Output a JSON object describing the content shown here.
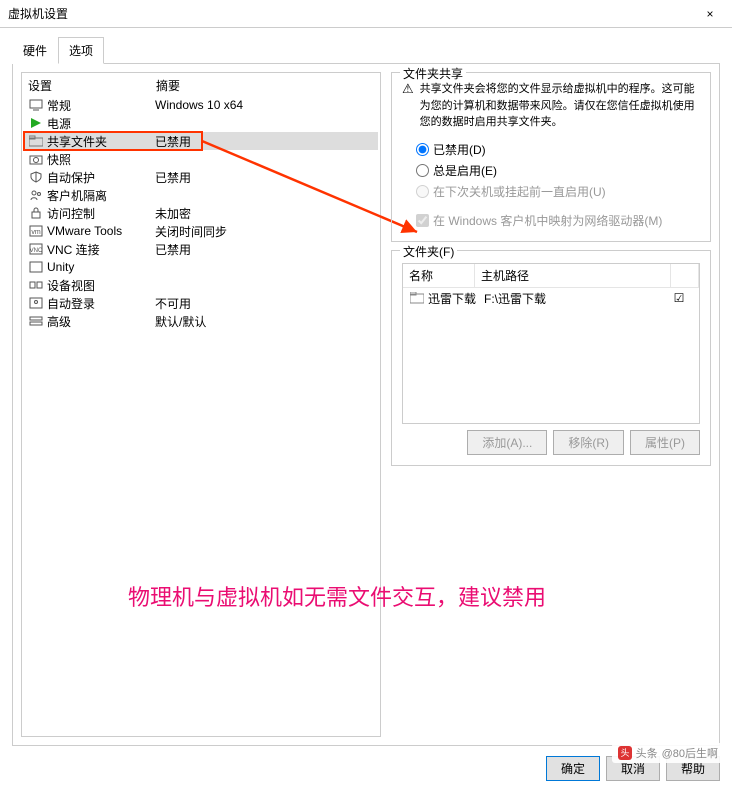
{
  "window": {
    "title": "虚拟机设置",
    "close_icon": "×"
  },
  "tabs": {
    "hardware": "硬件",
    "options": "选项"
  },
  "list": {
    "header": {
      "setting": "设置",
      "summary": "摘要"
    },
    "rows": [
      {
        "icon": "monitor",
        "label": "常规",
        "summary": "Windows 10 x64"
      },
      {
        "icon": "power",
        "label": "电源",
        "summary": ""
      },
      {
        "icon": "folder",
        "label": "共享文件夹",
        "summary": "已禁用",
        "selected": true
      },
      {
        "icon": "camera",
        "label": "快照",
        "summary": ""
      },
      {
        "icon": "shield",
        "label": "自动保护",
        "summary": "已禁用"
      },
      {
        "icon": "people",
        "label": "客户机隔离",
        "summary": ""
      },
      {
        "icon": "lock",
        "label": "访问控制",
        "summary": "未加密"
      },
      {
        "icon": "vm",
        "label": "VMware Tools",
        "summary": "关闭时间同步"
      },
      {
        "icon": "vnc",
        "label": "VNC 连接",
        "summary": "已禁用"
      },
      {
        "icon": "unity",
        "label": "Unity",
        "summary": ""
      },
      {
        "icon": "device",
        "label": "设备视图",
        "summary": ""
      },
      {
        "icon": "login",
        "label": "自动登录",
        "summary": "不可用"
      },
      {
        "icon": "adv",
        "label": "高级",
        "summary": "默认/默认"
      }
    ]
  },
  "share": {
    "group_title": "文件夹共享",
    "warning_icon": "⚠",
    "warning_text": "共享文件夹会将您的文件显示给虚拟机中的程序。这可能为您的计算机和数据带来风险。请仅在您信任虚拟机使用您的数据时启用共享文件夹。",
    "radio_disabled": "已禁用(D)",
    "radio_always": "总是启用(E)",
    "radio_until": "在下次关机或挂起前一直启用(U)",
    "checkbox_map": "在 Windows 客户机中映射为网络驱动器(M)"
  },
  "folders": {
    "group_title": "文件夹(F)",
    "header_name": "名称",
    "header_path": "主机路径",
    "row_name": "迅雷下载",
    "row_path": "F:\\迅雷下载",
    "row_checked": true,
    "btn_add": "添加(A)...",
    "btn_remove": "移除(R)",
    "btn_props": "属性(P)"
  },
  "buttons": {
    "ok": "确定",
    "cancel": "取消",
    "help": "帮助"
  },
  "annotation": "物理机与虚拟机如无需文件交互，建议禁用",
  "watermark": {
    "prefix": "头条",
    "handle": "@80后生啊"
  }
}
